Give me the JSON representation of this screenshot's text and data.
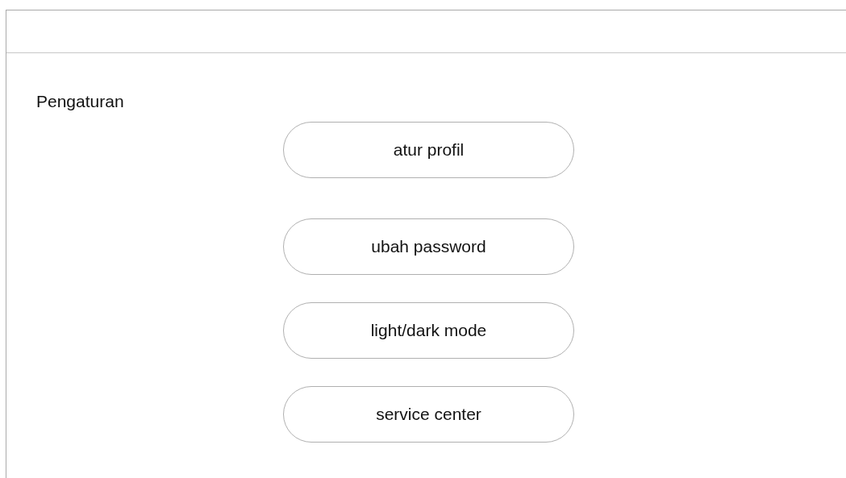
{
  "title": "Pengaturan",
  "buttons": [
    {
      "label": "atur profil"
    },
    {
      "label": "ubah password"
    },
    {
      "label": "light/dark mode"
    },
    {
      "label": "service center"
    }
  ]
}
